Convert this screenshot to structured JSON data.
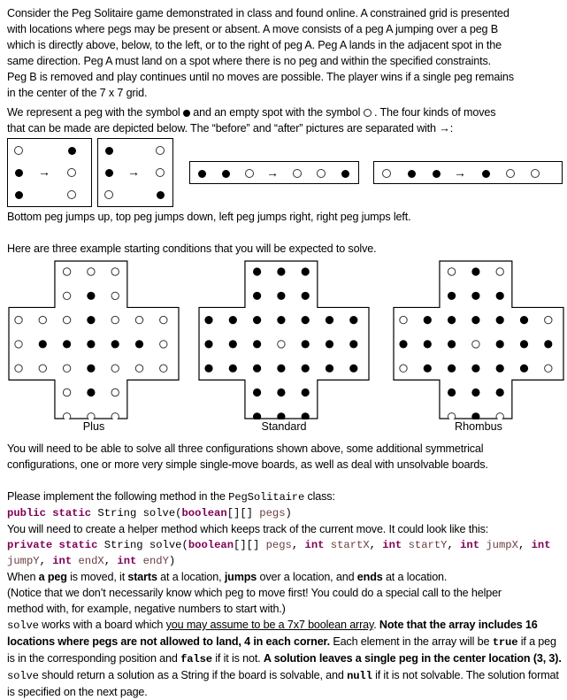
{
  "intro": {
    "lines": [
      "Consider the Peg Solitaire game demonstrated in class and found online. A constrained grid is presented",
      "with locations where pegs may be present or absent. A move consists of a peg A jumping over a peg B",
      "which is directly above, below, to the left, or to the right of peg A. Peg A lands in the adjacent spot in the",
      "same direction. Peg A must land on a spot where there is no peg and within the specified constraints.",
      "Peg B is removed and play continues until no moves are possible. The player wins if a single peg remains",
      "in the center of the 7 x 7 grid."
    ]
  },
  "symbols": {
    "line1_a": "We represent a peg with the symbol",
    "line1_b": "and an empty spot with the symbol",
    "line1_c": ". The four kinds of moves",
    "line2": "that can be made are depicted below. The “before” and “after” pictures are separated with",
    "arrow": "→",
    "line2_end": ":"
  },
  "moves": [
    {
      "name": "bottom-jumps-up",
      "orientation": "vertical",
      "before": [
        "empty",
        "peg",
        "peg"
      ],
      "after": [
        "peg",
        "empty",
        "empty"
      ]
    },
    {
      "name": "top-jumps-down",
      "orientation": "vertical",
      "before": [
        "peg",
        "peg",
        "empty"
      ],
      "after": [
        "empty",
        "empty",
        "peg"
      ]
    },
    {
      "name": "left-jumps-right",
      "orientation": "horizontal",
      "before": [
        "peg",
        "peg",
        "empty"
      ],
      "after": [
        "empty",
        "empty",
        "peg"
      ]
    },
    {
      "name": "right-jumps-left",
      "orientation": "horizontal",
      "before": [
        "empty",
        "peg",
        "peg"
      ],
      "after": [
        "peg",
        "empty",
        "empty"
      ]
    }
  ],
  "moves_caption": "Bottom peg jumps up, top peg jumps down, left peg jumps right, right peg jumps left.",
  "examples_intro": "Here are three example starting conditions that you will be expected to solve.",
  "boards": [
    {
      "label": "Plus",
      "grid": [
        "--ooo--",
        "--o#o--",
        "ooo#ooo",
        "o#####o",
        "ooo#ooo",
        "--o#o--",
        "--ooo--"
      ]
    },
    {
      "label": "Standard",
      "grid": [
        "--###--",
        "--###--",
        "#######",
        "###o###",
        "#######",
        "--###--",
        "--###--"
      ]
    },
    {
      "label": "Rhombus",
      "grid": [
        "--o#o--",
        "--###--",
        "o#####o",
        "###o###",
        "o#####o",
        "--###--",
        "--o#o--"
      ]
    }
  ],
  "solve_all": [
    "You will need to be able to solve all three configurations shown above, some additional symmetrical",
    "configurations, one or more very simple single-move boards, as well as deal with unsolvable boards."
  ],
  "implement": {
    "prefix": "Please implement the following method in the ",
    "class_name": "PegSolitaire",
    "suffix": " class:"
  },
  "signature_public": {
    "kw1": "public static",
    "type1": " String solve(",
    "kw2": "boolean",
    "rest": "[][] ",
    "param": "pegs",
    "close": ")"
  },
  "helper_intro": "You will need to create a helper method which keeps track of the current move. It could look like this:",
  "signature_private": {
    "kw1": "private static",
    "t1": " String solve(",
    "kw2": "boolean",
    "t2": "[][] ",
    "p1": "pegs",
    "t3": ", ",
    "kw3": "int",
    "p2": " startX",
    "t4": ", ",
    "kw4": "int",
    "p3": " startY",
    "t5": ", ",
    "kw5": "int",
    "p4": " jumpX",
    "t6": ", ",
    "kw6": "int",
    "p5": "jumpY",
    "t7": ", ",
    "kw7": "int",
    "p6": " endX",
    "t8": ", ",
    "kw8": "int",
    "p7": " endY",
    "t9": ")"
  },
  "move_desc": {
    "a": "When ",
    "b": "a peg",
    "c": " is moved, it ",
    "d": "starts",
    "e": " at a location, ",
    "f": "jumps",
    "g": " over a location, and ",
    "h": "ends",
    "i": " at a location."
  },
  "notice": [
    "(Notice that we don’t necessarily know which peg to move first! You could do a special call to the helper",
    "method with, for example, negative numbers to start with.)"
  ],
  "details": {
    "solve1": "solve",
    "t1": " works with a board which ",
    "u1": "you may assume to be a 7x7 boolean array",
    "t2": ". ",
    "b1": "Note that the array includes 16 locations where pegs are not allowed to land, 4 in each corner.",
    "t3": " Each element in the array will be ",
    "true_kw": "true",
    "t4": " if a peg is in the corresponding position and ",
    "false_kw": "false",
    "t5": " if it is not. ",
    "b2": "A solution leaves a single peg in the center location (3, 3).",
    "t6": " ",
    "solve2": "solve",
    "t7": " should return a solution as a String if the board is solvable, and ",
    "null_kw": "null",
    "t8": " if it is not solvable. The solution format is specified on the next page."
  }
}
